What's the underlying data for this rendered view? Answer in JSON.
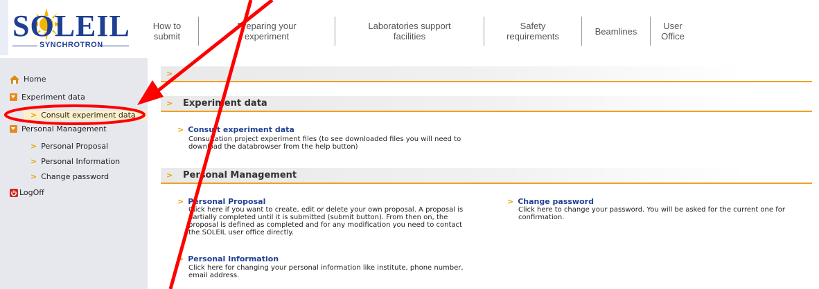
{
  "logo": {
    "word": "SOLEIL",
    "sub": "SYNCHROTRON"
  },
  "topnav": [
    {
      "label": "How to\nsubmit"
    },
    {
      "label": "Preparing your\nexperiment"
    },
    {
      "label": "Laboratories support\nfacilities"
    },
    {
      "label": "Safety\nrequirements"
    },
    {
      "label": "Beamlines"
    },
    {
      "label": "User\nOffice"
    }
  ],
  "sidebar": {
    "home": "Home",
    "experiment_data": "Experiment data",
    "consult_experiment_data": "Consult experiment data",
    "personal_management": "Personal Management",
    "personal_proposal": "Personal Proposal",
    "personal_information": "Personal Information",
    "change_password": "Change password",
    "logoff": "LogOff"
  },
  "main": {
    "experiment_data_title": "Experiment data",
    "consult": {
      "title": "Consult experiment data",
      "desc": "Consultation project experiment files (to see downloaded files you will need to download the databrowser from the help button)"
    },
    "personal_management_title": "Personal Management",
    "proposal": {
      "title": "Personal Proposal",
      "desc": "Click here if you want to create, edit or delete your own proposal. A proposal is partially completed until it is submitted (submit button). From then on, the proposal is defined as completed and for any modification you need to contact the SOLEIL user office directly."
    },
    "information": {
      "title": "Personal Information",
      "desc": "Click here for changing your personal information like institute, phone number, email address."
    },
    "password": {
      "title": "Change password",
      "desc": "Click here to change your password. You will be asked for the current one for confirmation."
    }
  },
  "colors": {
    "accent": "#f0a020",
    "link": "#1f3f93",
    "annotation": "#ff0000",
    "sidebar_bg": "#e6e8ee"
  }
}
